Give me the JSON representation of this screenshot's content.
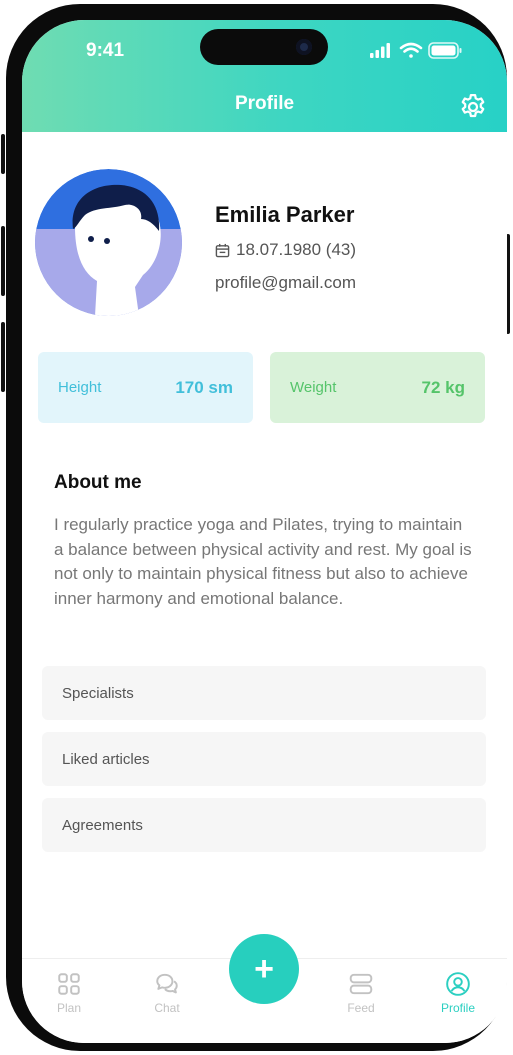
{
  "status_bar": {
    "time": "9:41"
  },
  "header": {
    "title": "Profile",
    "settings_icon": "gear-icon"
  },
  "profile": {
    "name": "Emilia Parker",
    "birthdate": "18.07.1980 (43)",
    "email": "profile@gmail.com"
  },
  "stats": {
    "height": {
      "label": "Height",
      "value": "170 sm"
    },
    "weight": {
      "label": "Weight",
      "value": "72 kg"
    }
  },
  "about": {
    "heading": "About me",
    "text": "I regularly practice yoga and Pilates, trying to maintain a balance between physical activity and rest. My goal is not only to maintain physical fitness but also to achieve inner harmony and emotional balance."
  },
  "menu": [
    {
      "label": "Specialists"
    },
    {
      "label": "Liked articles"
    },
    {
      "label": "Agreements"
    }
  ],
  "tabbar": {
    "tabs": [
      {
        "label": "Plan",
        "icon": "grid-icon"
      },
      {
        "label": "Chat",
        "icon": "chat-icon"
      },
      {
        "label": "Feed",
        "icon": "feed-icon"
      },
      {
        "label": "Profile",
        "icon": "profile-icon",
        "active": true
      }
    ],
    "fab_label": "+"
  },
  "colors": {
    "accent": "#27cfbe",
    "header_gradient_start": "#6fdcb2",
    "header_gradient_end": "#27d1c6",
    "height_card": "#e2f5fb",
    "weight_card": "#d9f2d9"
  }
}
